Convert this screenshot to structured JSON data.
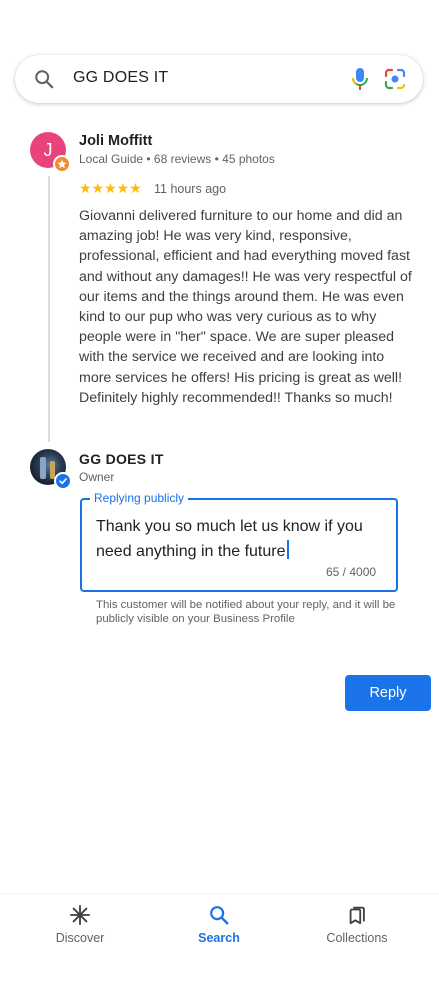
{
  "search": {
    "query": "GG DOES IT",
    "icons": [
      "search-icon",
      "microphone-icon",
      "google-lens-icon"
    ]
  },
  "review": {
    "avatar_letter": "J",
    "avatar_color": "#e8437a",
    "reviewer_name": "Joli Moffitt",
    "reviewer_meta": "Local Guide • 68 reviews • 45 photos",
    "rating_stars": 5,
    "stars_text": "★★★★★",
    "time": "11 hours ago",
    "text": "Giovanni delivered furniture to our home and did an amazing job! He was very kind, responsive, professional, efficient and had everything moved fast and without any damages!! He was very respectful of our items and the things around them. He was even kind to our pup who was very curious as to why people were in \"her\" space. We are super pleased with the service we received and are looking into more services he offers! His pricing is great as well! Definitely highly recommended!! Thanks so much!"
  },
  "owner": {
    "name": "GG DOES IT",
    "role": "Owner"
  },
  "reply": {
    "label": "Replying publicly",
    "text": "Thank you so much let us know if you need anything in the future",
    "counter": "65 / 4000",
    "notice": "This customer will be notified about your reply, and it will be publicly visible on your Business Profile",
    "button_label": "Reply"
  },
  "nav": {
    "items": [
      {
        "label": "Discover",
        "icon": "asterisk-icon",
        "active": false
      },
      {
        "label": "Search",
        "icon": "search-icon",
        "active": true
      },
      {
        "label": "Collections",
        "icon": "collections-icon",
        "active": false
      }
    ]
  },
  "colors": {
    "accent": "#1a73e8",
    "star": "#fbbc04",
    "local_guide_badge": "#f08c2e"
  }
}
